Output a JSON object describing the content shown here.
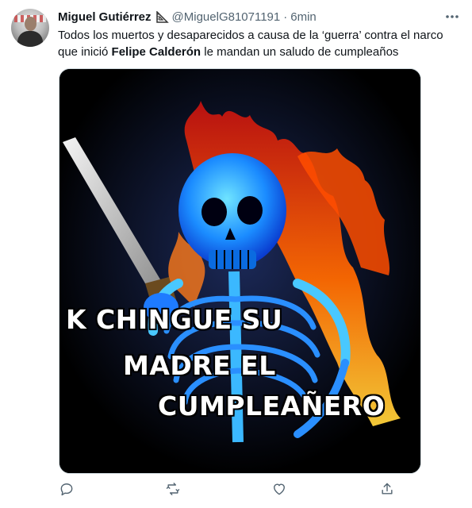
{
  "tweet": {
    "author_name": "Miguel Gutiérrez",
    "handle": "@MiguelG81071191",
    "separator": "·",
    "time": "6min",
    "text_part1": "Todos los muertos y desaparecidos a causa de la ‘guerra’ contra el narco que inició ",
    "text_bold": "Felipe Calderón",
    "text_part2": " le mandan un saludo de cumpleaños"
  },
  "media": {
    "caption_line1": "K CHINGUE SU",
    "caption_line2": "MADRE  EL",
    "caption_line3": "CUMPLEAÑERO"
  },
  "icons": {
    "more": "more-icon",
    "reply": "reply-icon",
    "retweet": "retweet-icon",
    "like": "like-icon",
    "share": "share-icon"
  },
  "colors": {
    "text": "#0f1419",
    "secondary": "#536471",
    "border": "#cfd9de"
  }
}
